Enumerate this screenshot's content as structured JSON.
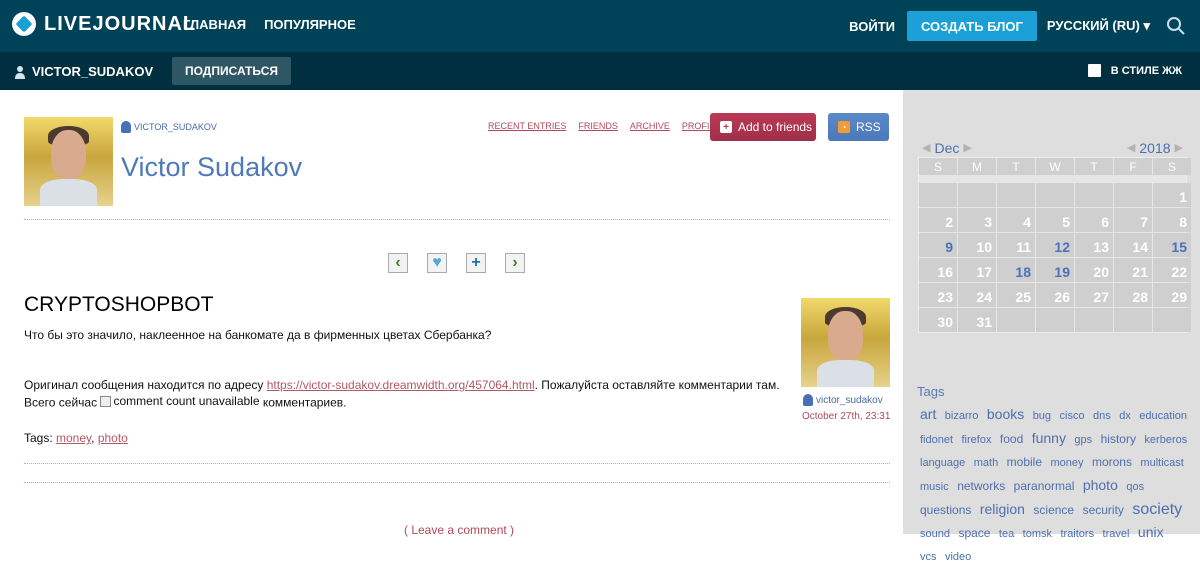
{
  "top": {
    "brand": "LIVEJOURNAL",
    "nav": [
      "ГЛАВНАЯ",
      "ПОПУЛЯРНОЕ"
    ],
    "login": "ВОЙТИ",
    "create_blog": "СОЗДАТЬ БЛОГ",
    "language": "РУССКИЙ (RU)",
    "colors": {
      "top_bg": "#004359",
      "sub_bg": "#00303f",
      "accent": "#1aa0d6"
    }
  },
  "subbar": {
    "username": "VICTOR_SUDAKOV",
    "subscribe": "ПОДПИСАТЬСЯ",
    "style_label": "В СТИЛЕ ЖЖ"
  },
  "journal": {
    "username": "VICTOR_SUDAKOV",
    "title": "Victor Sudakov",
    "links": [
      "RECENT ENTRIES",
      "FRIENDS",
      "ARCHIVE",
      "PROFILE"
    ],
    "add_friends": "Add to friends",
    "rss": "RSS"
  },
  "post": {
    "title": "CRYPTOSHOPBOT",
    "text1": "Что бы это значило, наклеенное на банкомате да в фирменных цветах Сбербанка?",
    "text2_prefix": "Оригинал сообщения находится по адресу ",
    "link": "https://victor-sudakov.dreamwidth.org/457064.html",
    "text2_suffix": ". Пожалуйста оставляйте комментарии там.",
    "text3_prefix": "Всего сейчас ",
    "broken_alt": "comment count unavailable",
    "text3_suffix": " комментариев.",
    "tags_label": "Tags: ",
    "tag1": "money",
    "tag2": "photo",
    "author": "victor_sudakov",
    "date": "October 27th, 23:31",
    "leave_comment": "( Leave a comment )"
  },
  "calendar": {
    "month": "Dec",
    "year": "2018",
    "days_header": [
      "S",
      "M",
      "T",
      "W",
      "T",
      "F",
      "S"
    ],
    "days": [
      "",
      "",
      "",
      "",
      "",
      "",
      "1",
      "2",
      "3",
      "4",
      "5",
      "6",
      "7",
      "8",
      "9",
      "10",
      "11",
      "12",
      "13",
      "14",
      "15",
      "16",
      "17",
      "18",
      "19",
      "20",
      "21",
      "22",
      "23",
      "24",
      "25",
      "26",
      "27",
      "28",
      "29",
      "30",
      "31",
      "",
      "",
      "",
      "",
      ""
    ],
    "active_days": [
      "9",
      "12",
      "15",
      "18",
      "19"
    ]
  },
  "tags": {
    "title": "Tags",
    "items": [
      {
        "text": "art",
        "size": 3
      },
      {
        "text": "bizarro",
        "size": 1
      },
      {
        "text": "books",
        "size": 3
      },
      {
        "text": "bug",
        "size": 1
      },
      {
        "text": "cisco",
        "size": 1
      },
      {
        "text": "dns",
        "size": 1
      },
      {
        "text": "dx",
        "size": 1
      },
      {
        "text": "education",
        "size": 1
      },
      {
        "text": "fidonet",
        "size": 1
      },
      {
        "text": "firefox",
        "size": 1
      },
      {
        "text": "food",
        "size": 2
      },
      {
        "text": "funny",
        "size": 3
      },
      {
        "text": "gps",
        "size": 1
      },
      {
        "text": "history",
        "size": 2
      },
      {
        "text": "kerberos",
        "size": 1
      },
      {
        "text": "language",
        "size": 1
      },
      {
        "text": "math",
        "size": 1
      },
      {
        "text": "mobile",
        "size": 2
      },
      {
        "text": "money",
        "size": 1
      },
      {
        "text": "morons",
        "size": 2
      },
      {
        "text": "multicast",
        "size": 1
      },
      {
        "text": "music",
        "size": 1
      },
      {
        "text": "networks",
        "size": 2
      },
      {
        "text": "paranormal",
        "size": 2
      },
      {
        "text": "photo",
        "size": 3
      },
      {
        "text": "qos",
        "size": 1
      },
      {
        "text": "questions",
        "size": 2
      },
      {
        "text": "religion",
        "size": 3
      },
      {
        "text": "science",
        "size": 2
      },
      {
        "text": "security",
        "size": 2
      },
      {
        "text": "society",
        "size": 4
      },
      {
        "text": "sound",
        "size": 1
      },
      {
        "text": "space",
        "size": 2
      },
      {
        "text": "tea",
        "size": 1
      },
      {
        "text": "tomsk",
        "size": 1
      },
      {
        "text": "traitors",
        "size": 1
      },
      {
        "text": "travel",
        "size": 1
      },
      {
        "text": "unix",
        "size": 3
      },
      {
        "text": "vcs",
        "size": 1
      },
      {
        "text": "video",
        "size": 1
      }
    ]
  }
}
